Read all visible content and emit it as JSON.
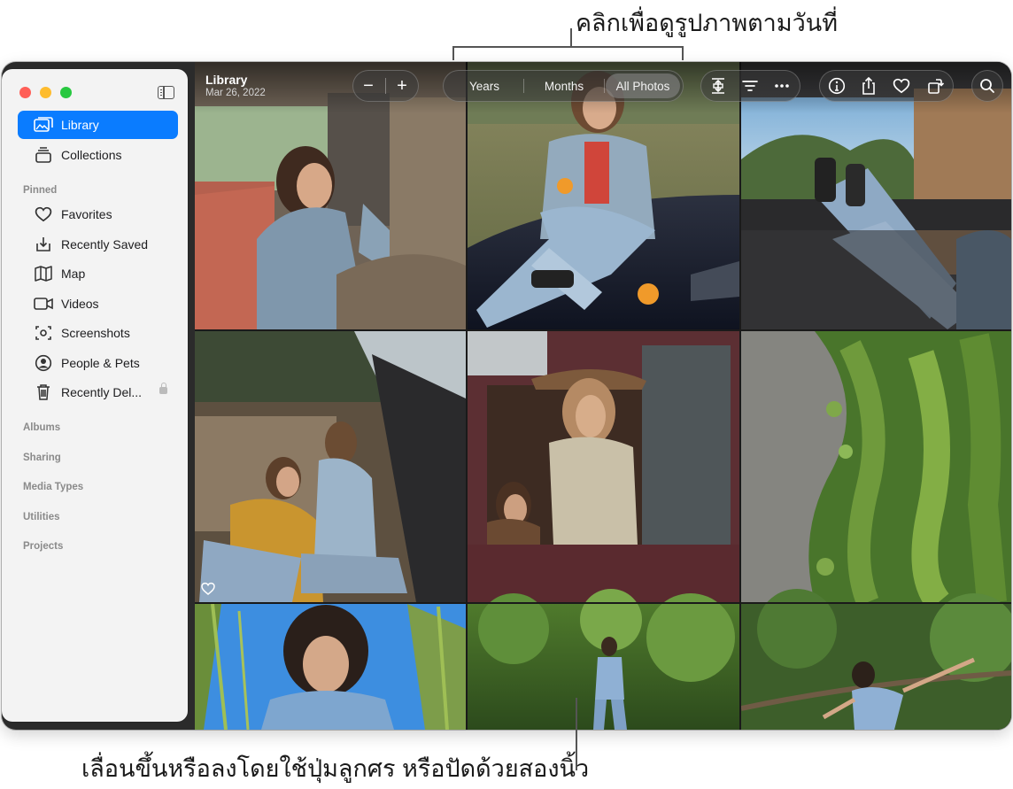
{
  "annotations": {
    "top": "คลิกเพื่อดูรูปภาพตามวันที่",
    "bottom": "เลื่อนขึ้นหรือลงโดยใช้ปุ่มลูกศร หรือปัดด้วยสองนิ้ว"
  },
  "sidebar": {
    "items": [
      {
        "label": "Library",
        "icon": "photo-library-icon",
        "selected": true
      },
      {
        "label": "Collections",
        "icon": "collections-stack-icon"
      }
    ],
    "pinned_header": "Pinned",
    "pinned": [
      {
        "label": "Favorites",
        "icon": "heart-icon"
      },
      {
        "label": "Recently Saved",
        "icon": "download-tray-icon"
      },
      {
        "label": "Map",
        "icon": "map-icon"
      },
      {
        "label": "Videos",
        "icon": "video-camera-icon"
      },
      {
        "label": "Screenshots",
        "icon": "screenshot-icon"
      },
      {
        "label": "People & Pets",
        "icon": "person-circle-icon"
      },
      {
        "label": "Recently Del...",
        "icon": "trash-icon",
        "locked": true
      }
    ],
    "sections": [
      "Albums",
      "Sharing",
      "Media Types",
      "Utilities",
      "Projects"
    ]
  },
  "toolbar": {
    "title": "Library",
    "date": "Mar 26, 2022",
    "zoom_out": "−",
    "zoom_in": "+",
    "segments": [
      "Years",
      "Months",
      "All Photos"
    ],
    "active_segment": "All Photos"
  },
  "colors": {
    "accent": "#0a7cff",
    "sidebar_bg": "#f3f3f3",
    "traffic_red": "#ff5f57",
    "traffic_yellow": "#febc2e",
    "traffic_green": "#28c840"
  }
}
